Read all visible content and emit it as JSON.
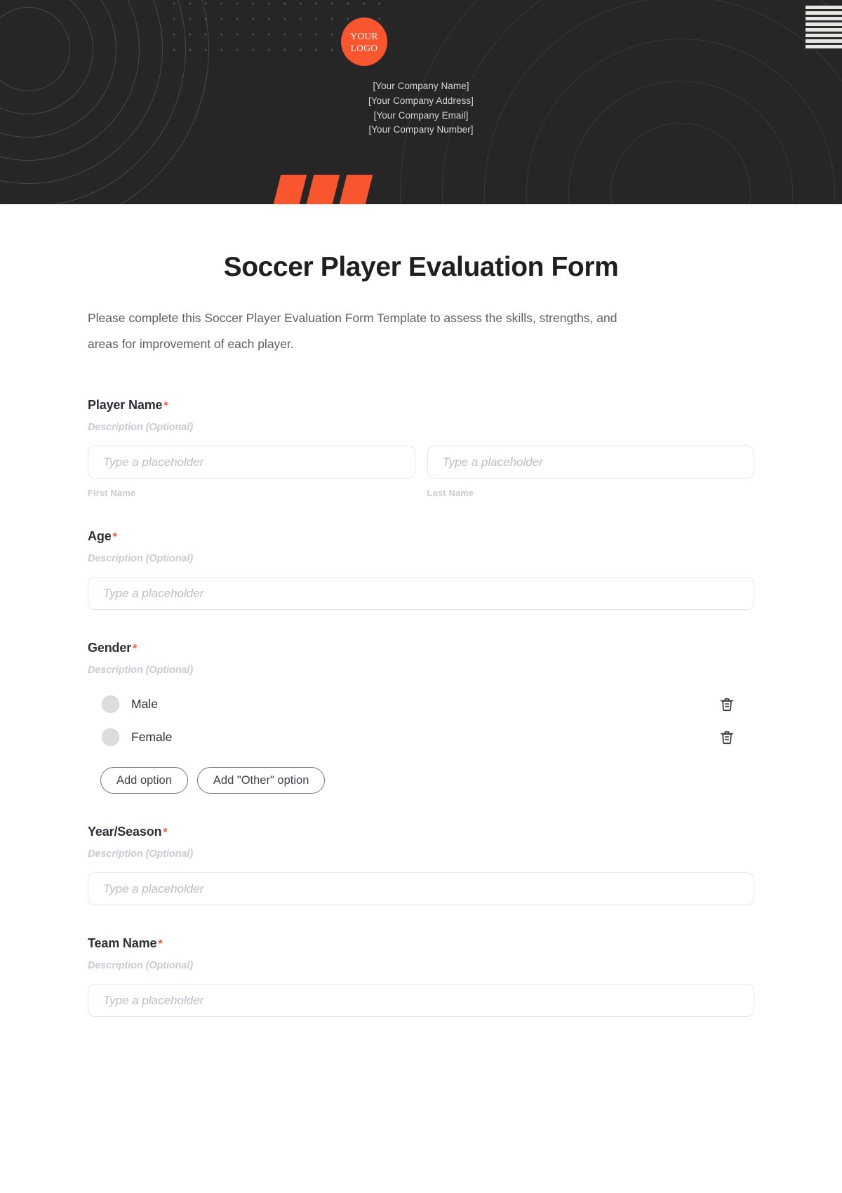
{
  "header": {
    "logo_line1": "YOUR",
    "logo_line2": "LOGO",
    "company_name": "[Your Company Name]",
    "company_address": "[Your Company Address]",
    "company_email": "[Your Company Email]",
    "company_number": "[Your Company Number]",
    "accent_color": "#f9552f",
    "background_color": "#262626"
  },
  "form": {
    "title": "Soccer Player Evaluation Form",
    "description": "Please complete this Soccer Player Evaluation Form Template to assess the skills, strengths, and areas for improvement of each player.",
    "required_marker": "*",
    "description_placeholder": "Description (Optional)",
    "input_placeholder": "Type a placeholder",
    "fields": [
      {
        "label": "Player Name",
        "description": "Description (Optional)",
        "type": "name",
        "required": true,
        "inputs": [
          {
            "placeholder": "Type a placeholder",
            "sublabel": "First Name"
          },
          {
            "placeholder": "Type a placeholder",
            "sublabel": "Last Name"
          }
        ]
      },
      {
        "label": "Age",
        "description": "Description (Optional)",
        "type": "text",
        "required": true,
        "placeholder": "Type a placeholder"
      },
      {
        "label": "Gender",
        "description": "Description (Optional)",
        "type": "radio",
        "required": true,
        "options": [
          {
            "label": "Male",
            "delete_icon": "trash-icon"
          },
          {
            "label": "Female",
            "delete_icon": "trash-icon"
          }
        ],
        "add_option_label": "Add option",
        "add_other_option_label": "Add \"Other\" option"
      },
      {
        "label": "Year/Season",
        "description": "Description (Optional)",
        "type": "text",
        "required": true,
        "placeholder": "Type a placeholder"
      },
      {
        "label": "Team Name",
        "description": "Description (Optional)",
        "type": "text",
        "required": true,
        "placeholder": "Type a placeholder"
      }
    ]
  }
}
